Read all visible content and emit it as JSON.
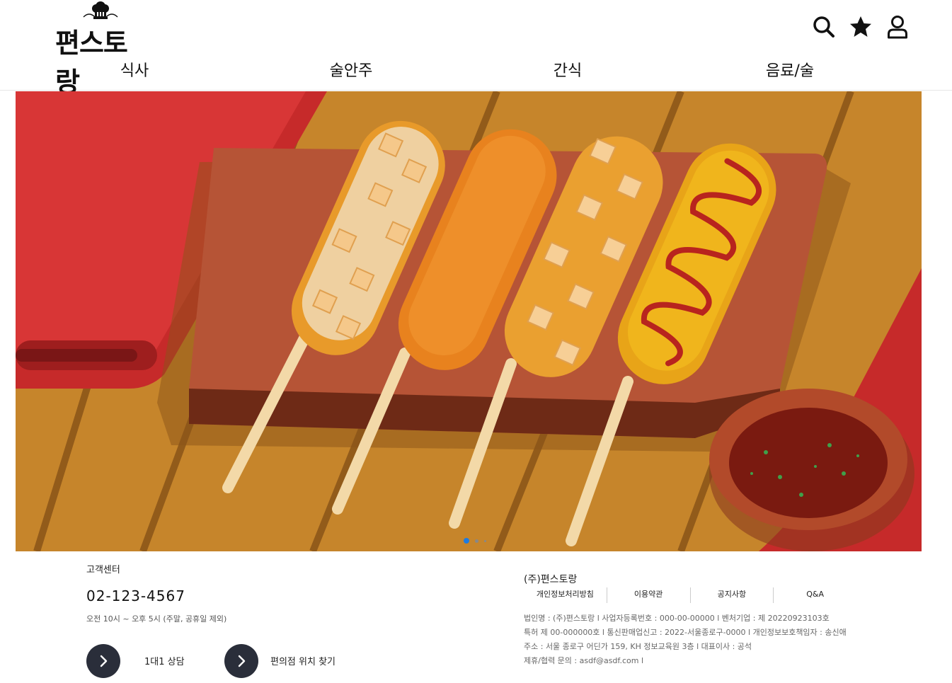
{
  "brand": {
    "logo_text": "편스토랑"
  },
  "header": {
    "icons": [
      "search-icon",
      "star-icon",
      "user-icon"
    ],
    "nav": [
      {
        "label": "식사"
      },
      {
        "label": "술안주"
      },
      {
        "label": "간식"
      },
      {
        "label": "음료/술"
      }
    ]
  },
  "banner": {
    "image": "corn-dogs-illustration",
    "slides_total": 3,
    "active_slide": 1
  },
  "customer_center": {
    "title": "고객센터",
    "phone": "02-123-4567",
    "hours": "오전 10시 ~ 오후 5시 (주말, 공휴일 제외)",
    "buttons": [
      {
        "label": "1대1 상담",
        "icon": "chevron-right-icon"
      },
      {
        "label": "편의점 위치 찾기",
        "icon": "chevron-right-icon"
      }
    ]
  },
  "company": {
    "name": "(주)편스토랑",
    "links": [
      "개인정보처리방침",
      "이용약관",
      "공지사항",
      "Q&A"
    ],
    "info": [
      "법인명 : (주)편스토랑 l 사업자등록번호 : 000-00-00000 l 벤처기업 : 제 20220923103호",
      "특허 제 00-000000호 l 통신판매업신고 : 2022-서울종로구-0000 l 개인정보보호책임자 : 송신애",
      "주소 : 서울 종로구 어딘가 159, KH 정보교육원 3층 l 대표이사 : 공석",
      "제휴/협력 문의 : asdf@asdf.com l"
    ]
  },
  "colors": {
    "dot_active": "#1e7be0",
    "dot_inactive": "#888888",
    "button_dark": "#2a2e3a"
  }
}
